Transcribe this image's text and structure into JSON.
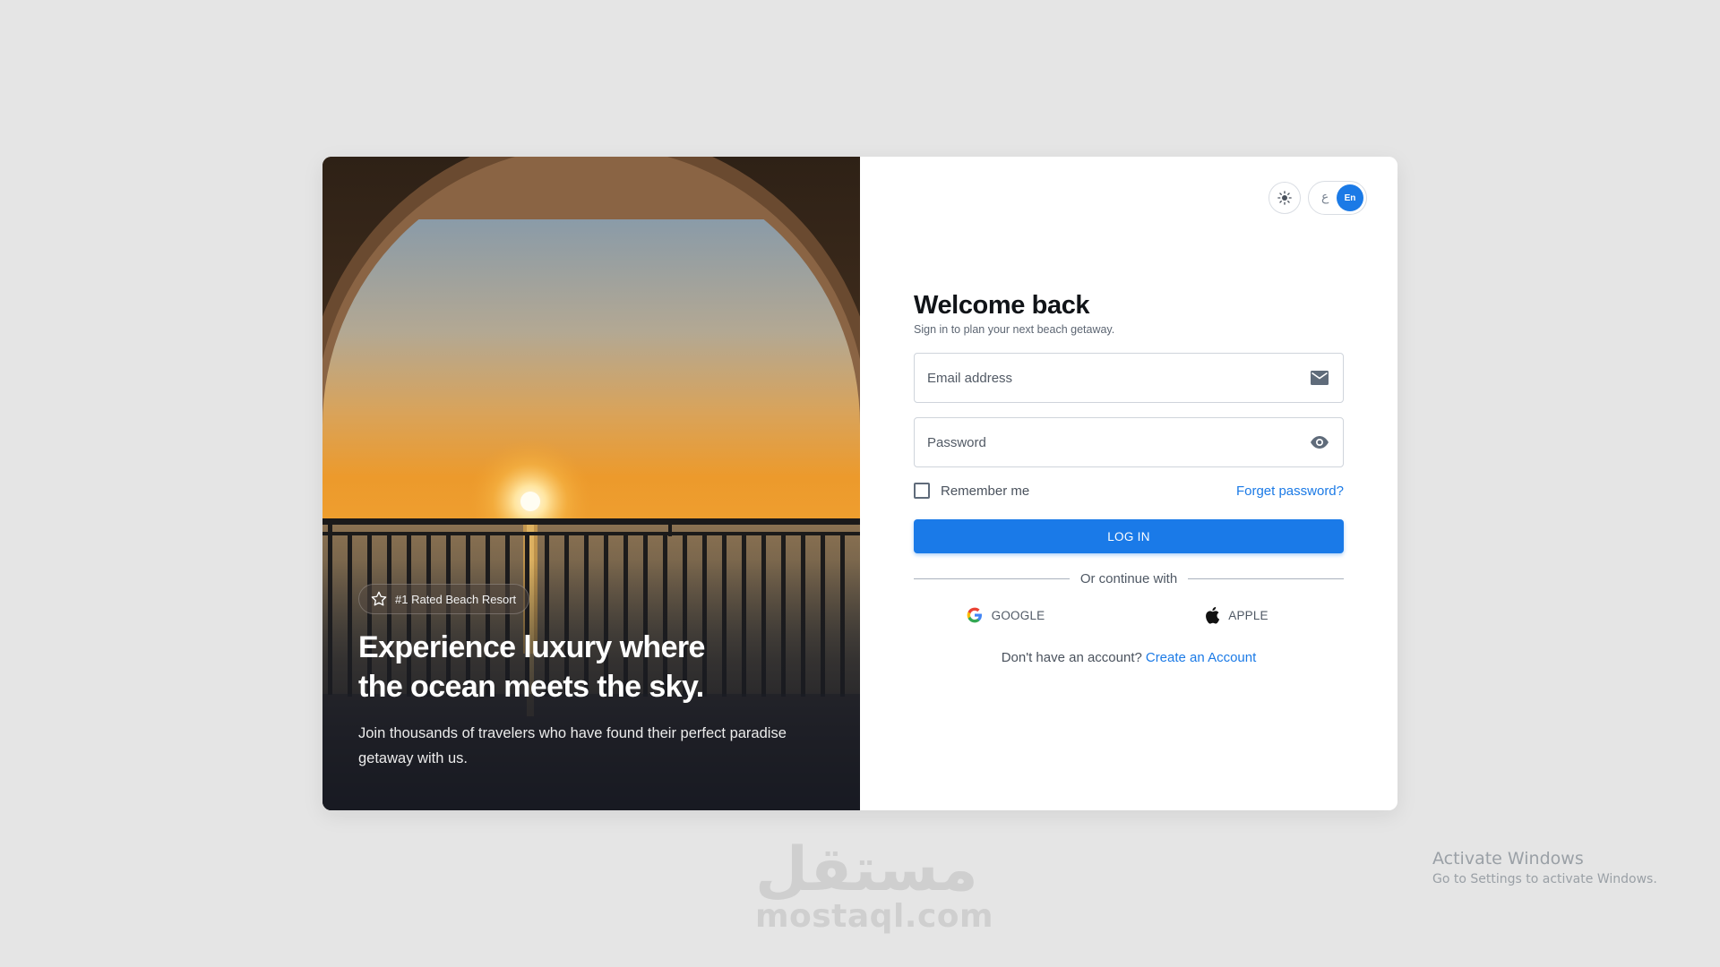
{
  "hero": {
    "badge_text": "#1 Rated Beach Resort",
    "badge_icon": "star-outline-icon",
    "title": "Experience luxury where the ocean meets the sky.",
    "subtitle": "Join thousands of travelers who have found their perfect paradise getaway with us."
  },
  "header": {
    "theme_icon": "sun-icon",
    "lang_ar": "ع",
    "lang_en": "En"
  },
  "form": {
    "title": "Welcome back",
    "subtitle": "Sign in to plan your next beach getaway.",
    "email_placeholder": "Email address",
    "email_icon": "envelope-icon",
    "password_placeholder": "Password",
    "password_icon": "eye-icon",
    "remember_label": "Remember me",
    "forgot_label": "Forget password?",
    "login_label": "LOG IN",
    "divider_label": "Or continue with",
    "google_label": "GOOGLE",
    "apple_label": "APPLE",
    "signup_prompt": "Don't have an account?",
    "signup_link": "Create an Account"
  },
  "colors": {
    "accent": "#1a7ae8",
    "page_background": "#e5e5e5"
  },
  "watermark": {
    "arabic": "مستقل",
    "domain": "mostaql.com"
  },
  "activation": {
    "title": "Activate Windows",
    "subtitle": "Go to Settings to activate Windows."
  }
}
